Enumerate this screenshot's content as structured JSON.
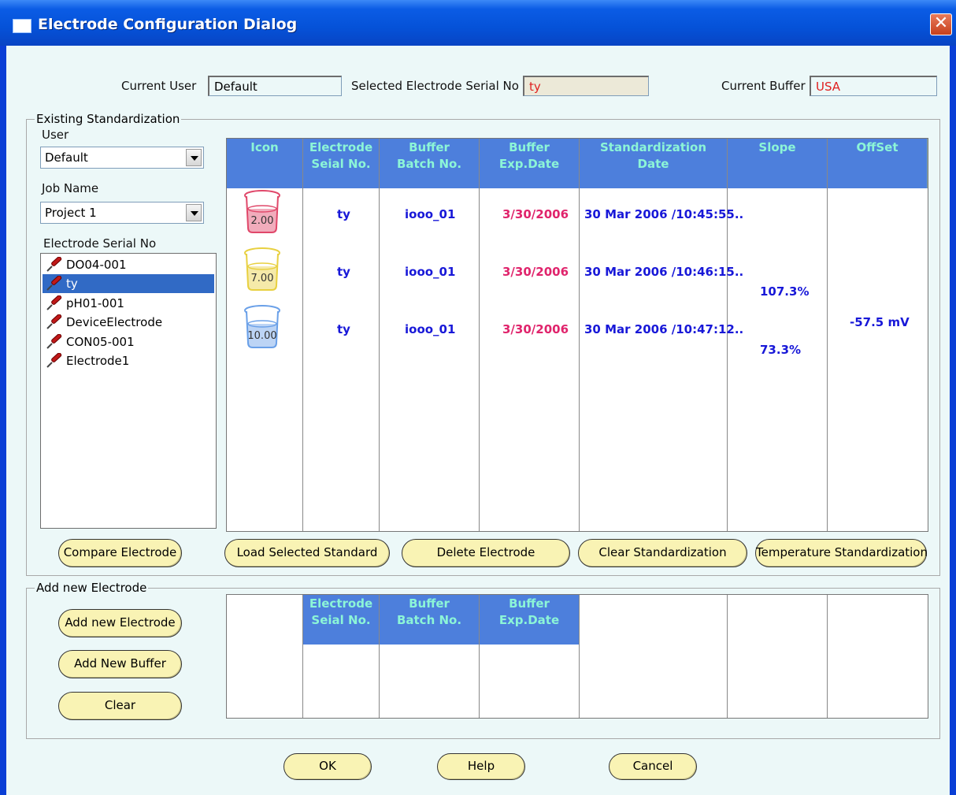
{
  "window": {
    "title": "Electrode Configuration Dialog"
  },
  "top": {
    "current_user_label": "Current User",
    "current_user_value": "Default",
    "selected_serial_label": "Selected Electrode Serial No",
    "selected_serial_value": "ty",
    "current_buffer_label": "Current Buffer",
    "current_buffer_value": "USA"
  },
  "existing": {
    "group_title": "Existing Standardization",
    "user_label": "User",
    "user_value": "Default",
    "job_label": "Job Name",
    "job_value": "Project 1",
    "serial_list_label": "Electrode Serial No",
    "serials": [
      "DO04-001",
      "ty",
      "pH01-001",
      "DeviceElectrode",
      "CON05-001",
      "Electrode1"
    ],
    "selected_serial_index": 1,
    "table_headers": {
      "icon": "Icon",
      "serial": [
        "Electrode",
        "Seial No."
      ],
      "batch": [
        "Buffer",
        "Batch No."
      ],
      "exp": [
        "Buffer",
        "Exp.Date"
      ],
      "std_date": [
        "Standardization",
        "Date"
      ],
      "slope": "Slope",
      "offset": "OffSet"
    },
    "rows": [
      {
        "buffer": "2.00",
        "serial": "ty",
        "batch": "iooo_01",
        "exp": "3/30/2006",
        "std_date": "30 Mar 2006 /10:45:55.."
      },
      {
        "buffer": "7.00",
        "serial": "ty",
        "batch": "iooo_01",
        "exp": "3/30/2006",
        "std_date": "30 Mar 2006 /10:46:15.."
      },
      {
        "buffer": "10.00",
        "serial": "ty",
        "batch": "iooo_01",
        "exp": "3/30/2006",
        "std_date": "30 Mar 2006 /10:47:12.."
      }
    ],
    "slopes": [
      "107.3%",
      "73.3%"
    ],
    "offset": "-57.5 mV",
    "buttons": {
      "compare": "Compare Electrode",
      "load": "Load Selected Standard",
      "delete": "Delete Electrode",
      "clear_std": "Clear Standardization",
      "temp_std": "Temperature Standardization"
    }
  },
  "add_new": {
    "group_title": "Add new Electrode",
    "buttons": {
      "add_electrode": "Add new Electrode",
      "add_buffer": "Add New Buffer",
      "clear": "Clear"
    },
    "table_headers": {
      "serial": [
        "Electrode",
        "Seial No."
      ],
      "batch": [
        "Buffer",
        "Batch No."
      ],
      "exp": [
        "Buffer",
        "Exp.Date"
      ]
    }
  },
  "footer": {
    "ok": "OK",
    "help": "Help",
    "cancel": "Cancel"
  },
  "colors": {
    "header_bg": "#4d7fdc",
    "header_text": "#8cf5d7",
    "value_blue": "#1818d8",
    "value_red": "#e0246c",
    "button_bg": "#f9f3b4",
    "beaker_2": "#e0486a",
    "beaker_7": "#e8d040",
    "beaker_10": "#6aa0e8"
  }
}
